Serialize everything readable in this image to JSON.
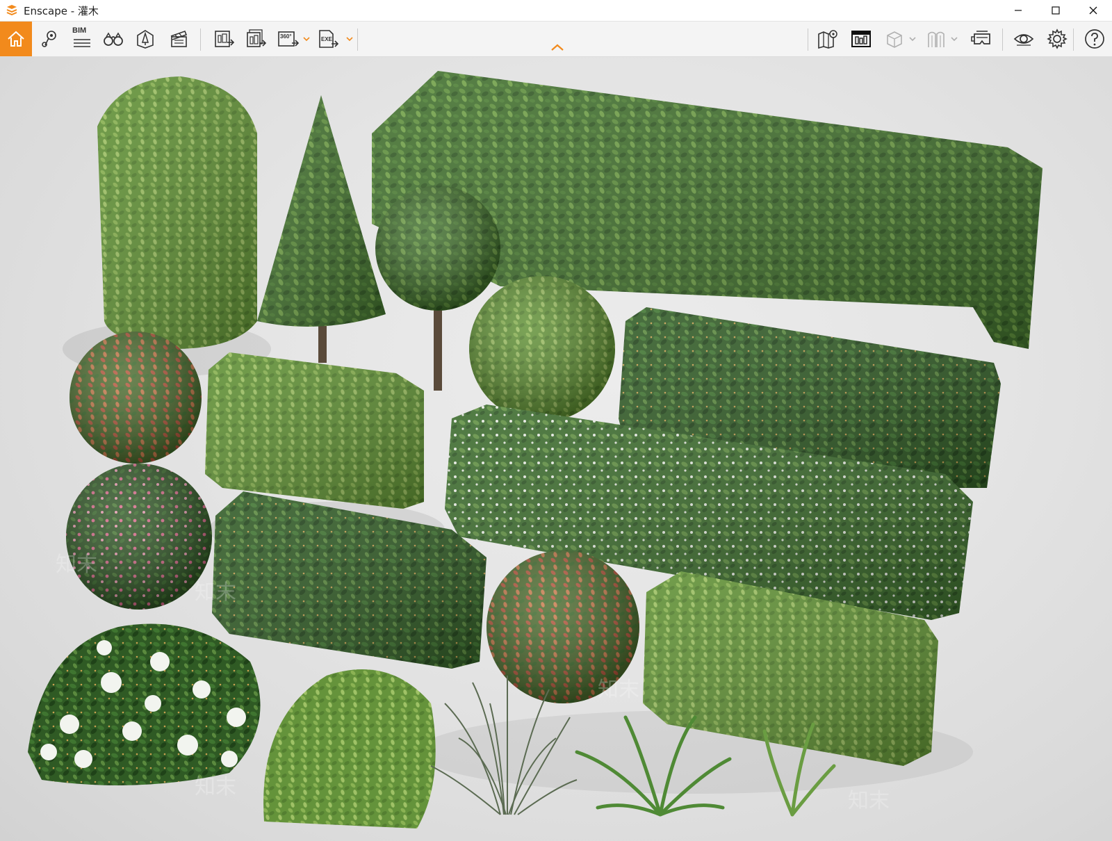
{
  "window": {
    "title": "Enscape - 灌木",
    "controls": [
      "minimize-icon",
      "maximize-icon",
      "close-icon"
    ]
  },
  "toolbar": {
    "left_tools": [
      {
        "name": "home",
        "icon": "home-icon",
        "active": true
      },
      {
        "name": "views",
        "icon": "map-pin-icon"
      },
      {
        "name": "bim",
        "icon": "bim-icon",
        "label": "BIM"
      },
      {
        "name": "binoculars",
        "icon": "binoculars-icon"
      },
      {
        "name": "asset-library",
        "icon": "asset-library-icon"
      },
      {
        "name": "video-editor",
        "icon": "clapperboard-icon"
      }
    ],
    "export_tools": [
      {
        "name": "screenshot",
        "icon": "render-image-icon"
      },
      {
        "name": "batch-render",
        "icon": "batch-render-icon"
      },
      {
        "name": "panorama",
        "icon": "panorama-icon",
        "label": "360°",
        "has_dropdown": true
      },
      {
        "name": "export-exe",
        "icon": "exe-export-icon",
        "label": "EXE",
        "has_dropdown": true
      }
    ],
    "right_tools": [
      {
        "name": "map",
        "icon": "map-icon"
      },
      {
        "name": "bim-info",
        "icon": "bim-info-icon"
      },
      {
        "name": "box",
        "icon": "box-icon",
        "disabled": true,
        "has_dropdown": true
      },
      {
        "name": "vr",
        "icon": "vr-icon",
        "disabled": true,
        "has_dropdown": true
      },
      {
        "name": "vr-headset",
        "icon": "vr-headset-icon"
      },
      {
        "name": "visual-settings",
        "icon": "eye-icon"
      },
      {
        "name": "settings",
        "icon": "gear-icon"
      },
      {
        "name": "help",
        "icon": "help-icon"
      }
    ],
    "collapse": "chevron-up-icon"
  },
  "colors": {
    "accent": "#f28a1c",
    "toolbar_bg": "#f4f4f4",
    "viewport_bg": "#e4e4e4",
    "foliage_dark": "#2f5a24",
    "foliage_mid": "#4c7d32",
    "foliage_light": "#7aa548"
  },
  "viewport": {
    "scene": "shrubs-asset-collection",
    "watermark": "知末"
  }
}
